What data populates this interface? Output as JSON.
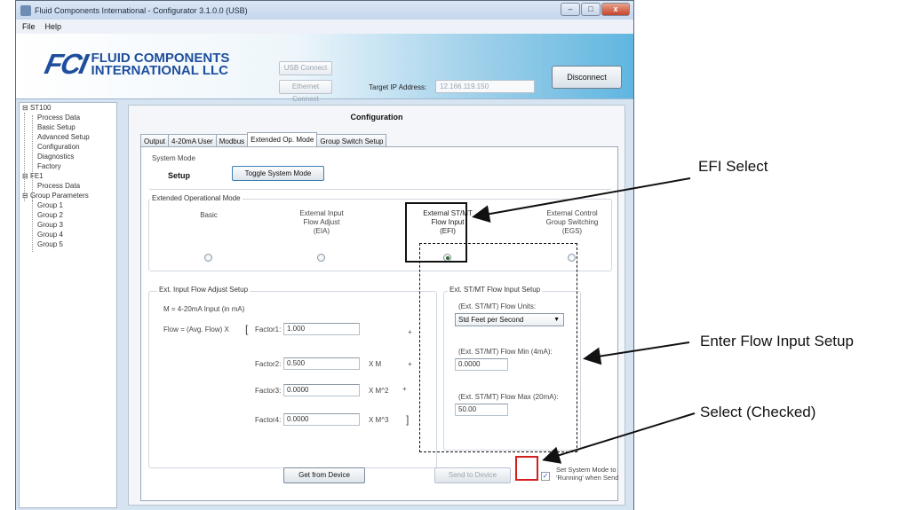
{
  "window": {
    "title": "Fluid Components International - Configurator 3.1.0.0 (USB)",
    "controls": {
      "minimize": "–",
      "maximize": "□",
      "close": "x"
    }
  },
  "menu": [
    "File",
    "Help"
  ],
  "header": {
    "logo_mark": "FCI",
    "logo_line1": "FLUID COMPONENTS",
    "logo_line2": "INTERNATIONAL LLC",
    "usb_connect": "USB Connect",
    "ethernet_connect": "Ethernet Connect",
    "target_ip_label": "Target IP Address:",
    "target_ip_value": "12.166.119.150",
    "disconnect": "Disconnect"
  },
  "tree": {
    "st100": "ST100",
    "st100_children": [
      "Process Data",
      "Basic Setup",
      "Advanced Setup",
      "Configuration",
      "Diagnostics",
      "Factory"
    ],
    "fe1": "FE1",
    "fe1_children": [
      "Process Data"
    ],
    "group_params": "Group Parameters",
    "groups": [
      "Group 1",
      "Group 2",
      "Group 3",
      "Group 4",
      "Group 5"
    ]
  },
  "panel": {
    "title": "Configuration",
    "tabs": [
      "Output",
      "4-20mA User",
      "Modbus",
      "Extended Op. Mode",
      "Group Switch Setup"
    ],
    "active_tab": "Extended Op. Mode"
  },
  "system_mode": {
    "label": "System Mode",
    "value": "Setup",
    "toggle": "Toggle System Mode"
  },
  "ext_op_mode": {
    "label": "Extended Operational Mode",
    "basic": "Basic",
    "eia_l1": "External Input",
    "eia_l2": "Flow Adjust",
    "eia_l3": "(EIA)",
    "efi_l1": "External ST/MT",
    "efi_l2": "Flow Input",
    "efi_l3": "(EFI)",
    "egs_l1": "External Control",
    "egs_l2": "Group Switching",
    "egs_l3": "(EGS)",
    "selected": "EFI"
  },
  "flow_adjust": {
    "label": "Ext. Input Flow Adjust Setup",
    "m_def": "M = 4-20mA Input (in mA)",
    "formula": "Flow = (Avg. Flow) X",
    "bracket_open": "[",
    "bracket_close": "]",
    "factor1_label": "Factor1:",
    "factor1": "1.000",
    "factor2_label": "Factor2:",
    "factor2": "0.500",
    "factor3_label": "Factor3:",
    "factor3": "0.0000",
    "factor4_label": "Factor4:",
    "factor4": "0.0000",
    "plus": "+",
    "xm": "X M",
    "xm2": "X M^2",
    "xm3": "X M^3"
  },
  "flow_input": {
    "label": "Ext. ST/MT Flow Input Setup",
    "units_label": "(Ext. ST/MT) Flow Units:",
    "units_value": "Std Feet per Second",
    "min_label": "(Ext. ST/MT) Flow Min (4mA):",
    "min_value": "0.0000",
    "max_label": "(Ext. ST/MT) Flow Max (20mA):",
    "max_value": "50.00"
  },
  "actions": {
    "get": "Get from Device",
    "send": "Send to Device",
    "set_running_l1": "Set System Mode to",
    "set_running_l2": "'Running' when Send",
    "set_running_checked": true
  },
  "annotations": {
    "efi_select": "EFI Select",
    "enter_flow": "Enter Flow Input Setup",
    "select_checked": "Select (Checked)"
  }
}
